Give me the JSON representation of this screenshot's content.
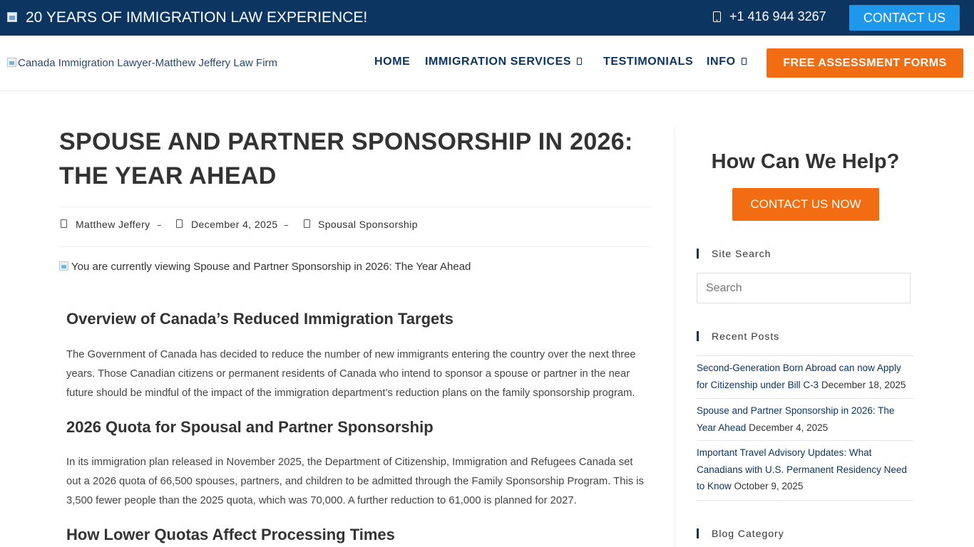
{
  "topbar": {
    "tagline": "20 YEARS OF IMMIGRATION LAW EXPERIENCE!",
    "phone": "+1 416 944 3267",
    "contact_label": "CONTACT US",
    "flag_icon": "broken-image-icon",
    "phone_icon": "mobile-phone-icon"
  },
  "header": {
    "logo_alt": "Canada Immigration Lawyer-Matthew Jeffery Law Firm",
    "nav": {
      "home": "HOME",
      "immigration_services": "IMMIGRATION SERVICES",
      "testimonials": "TESTIMONIALS",
      "info": "INFO"
    },
    "cta_label": "FREE ASSESSMENT FORMS"
  },
  "article": {
    "title": "SPOUSE AND PARTNER SPONSORSHIP IN 2026: THE YEAR AHEAD",
    "meta": {
      "author": "Matthew Jeffery",
      "date": "December 4, 2025",
      "category": "Spousal Sponsorship"
    },
    "featured_alt": "You are currently viewing Spouse and Partner Sponsorship in 2026: The Year Ahead",
    "sections": [
      {
        "heading": "Overview of Canada’s Reduced Immigration Targets",
        "body": "The Government of Canada has decided to reduce the number of new immigrants entering the country over the next three years. Those Canadian citizens or permanent residents of Canada who intend to sponsor a spouse or partner in the near future should be mindful of the impact of the immigration department’s reduction plans on the family sponsorship program."
      },
      {
        "heading": "2026 Quota for Spousal and Partner Sponsorship",
        "body": "In its immigration plan released in November 2025, the Department of Citizenship, Immigration and Refugees Canada set out a 2026 quota of 66,500 spouses, partners, and children to be admitted through the Family Sponsorship Program. This is 3,500 fewer people than the 2025 quota, which was 70,000. A further reduction to 61,000 is planned for 2027."
      },
      {
        "heading": "How Lower Quotas Affect Processing Times"
      }
    ]
  },
  "sidebar": {
    "help_title": "How Can We Help?",
    "help_button": "CONTACT US NOW",
    "site_search_title": "Site Search",
    "search_placeholder": "Search",
    "recent_posts_title": "Recent Posts",
    "recent_posts": [
      {
        "title": "Second-Generation Born Abroad can now Apply for Citizenship under Bill C-3",
        "date": "December 18, 2025"
      },
      {
        "title": "Spouse and Partner Sponsorship in 2026: The Year Ahead",
        "date": "December 4, 2025"
      },
      {
        "title": "Important Travel Advisory Updates: What Canadians with U.S. Permanent Residency Need to Know",
        "date": "October 9, 2025"
      }
    ],
    "blog_category_title": "Blog Category"
  },
  "colors": {
    "navy": "#0c3661",
    "orange": "#f26d12",
    "blue": "#1d98ea"
  }
}
